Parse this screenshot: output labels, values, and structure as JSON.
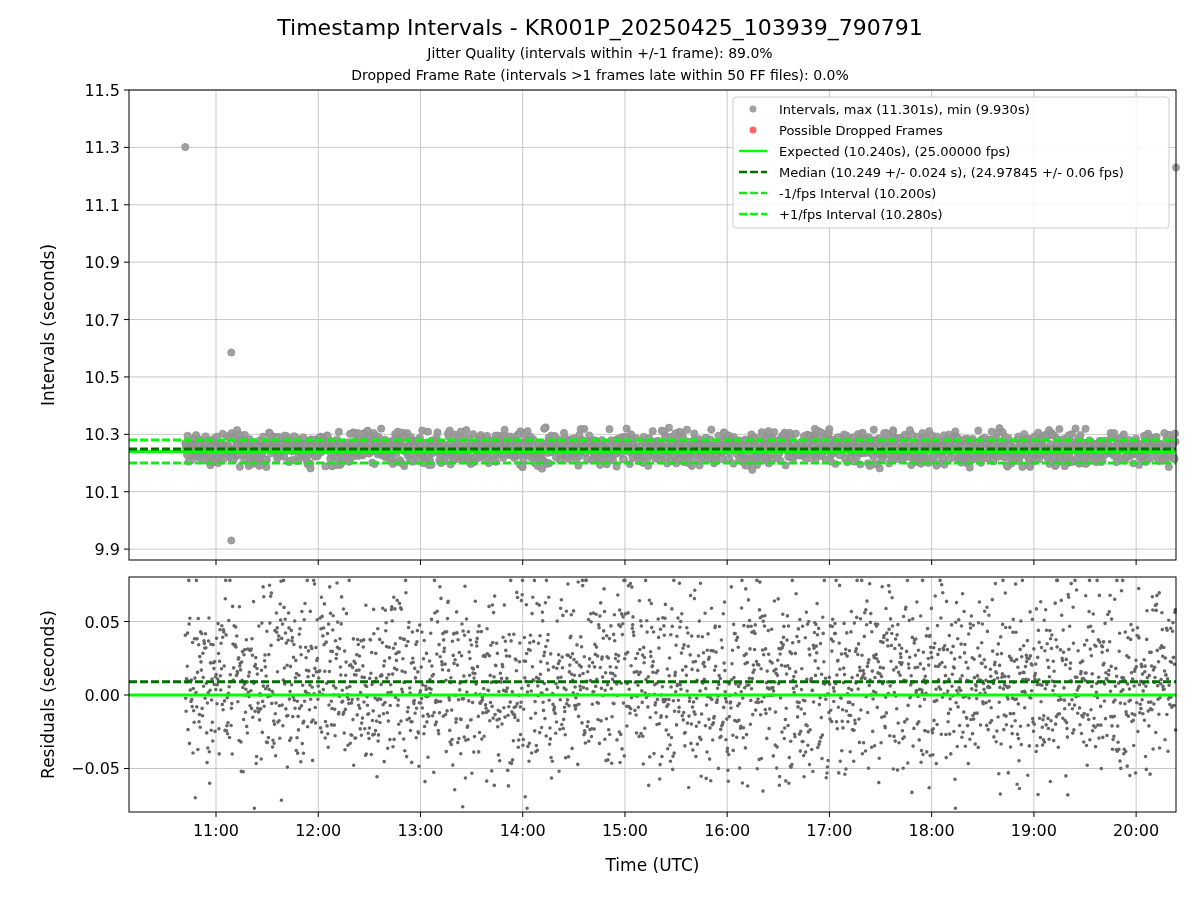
{
  "figure": {
    "title": "Timestamp Intervals - KR001P_20250425_103939_790791",
    "subtitles": [
      "Jitter Quality (intervals within +/-1 frame): 89.0%",
      "Dropped Frame Rate (intervals >1 frames late within 50 FF files): 0.0%"
    ]
  },
  "top_panel": {
    "legend_markers": [
      {
        "label": "Intervals, max (11.301s), min (9.930s)",
        "color": "#a0a0a0"
      },
      {
        "label": "Possible Dropped Frames",
        "color": "#ff6464"
      }
    ],
    "chart_data": {
      "type": "line",
      "ylabel": "Intervals (seconds)",
      "xlim": [
        10.149,
        20.39
      ],
      "ylim": [
        9.862,
        11.5
      ],
      "x": [
        10.149,
        20.39
      ],
      "grid": true,
      "legend": true,
      "yticks": [
        {
          "value": 9.9,
          "label": "9.9"
        },
        {
          "value": 10.1,
          "label": "10.1"
        },
        {
          "value": 10.3,
          "label": "10.3"
        },
        {
          "value": 10.5,
          "label": "10.5"
        },
        {
          "value": 10.7,
          "label": "10.7"
        },
        {
          "value": 10.9,
          "label": "10.9"
        },
        {
          "value": 11.1,
          "label": "11.1"
        },
        {
          "value": 11.3,
          "label": "11.3"
        },
        {
          "value": 11.5,
          "label": "11.5"
        }
      ],
      "series": [
        {
          "name": "Expected (10.240s), (25.00000 fps)",
          "color": "#00ff00",
          "line_style": "solid",
          "values": [
            10.24,
            10.24
          ]
        },
        {
          "name": "Median (10.249 +/- 0.024 s), (24.97845 +/- 0.06 fps)",
          "color": "#007000",
          "line_style": "dashed",
          "values": [
            10.249,
            10.249
          ]
        },
        {
          "name": "-1/fps Interval (10.200s)",
          "color": "#22e022",
          "line_style": "dashed",
          "values": [
            10.2,
            10.2
          ]
        },
        {
          "name": "+1/fps Interval (10.280s)",
          "color": "#00ff00",
          "line_style": "dashed",
          "values": [
            10.28,
            10.28
          ]
        }
      ]
    }
  },
  "bottom_panel": {
    "chart_data": {
      "type": "scatter",
      "xlabel": "Time (UTC)",
      "ylabel": "Residuals (seconds)",
      "xlim": [
        10.149,
        20.39
      ],
      "ylim": [
        -0.0796,
        0.0803
      ],
      "xticks": [
        {
          "value": 11,
          "label": "11:00"
        },
        {
          "value": 12,
          "label": "12:00"
        },
        {
          "value": 13,
          "label": "13:00"
        },
        {
          "value": 14,
          "label": "14:00"
        },
        {
          "value": 15,
          "label": "15:00"
        },
        {
          "value": 16,
          "label": "16:00"
        },
        {
          "value": 17,
          "label": "17:00"
        },
        {
          "value": 18,
          "label": "18:00"
        },
        {
          "value": 19,
          "label": "19:00"
        },
        {
          "value": 20,
          "label": "20:00"
        }
      ],
      "grid": true,
      "yticks": [
        {
          "value": -0.05,
          "label": "−0.05"
        },
        {
          "value": 0,
          "label": "0.00"
        },
        {
          "value": 0.05,
          "label": "0.05"
        }
      ],
      "ref_lines": [
        {
          "axis": "y",
          "value": 0,
          "color": "#00ff00",
          "line_style": "solid"
        },
        {
          "axis": "y",
          "value": 0.009,
          "color": "#007000",
          "line_style": "dashed"
        }
      ]
    }
  }
}
